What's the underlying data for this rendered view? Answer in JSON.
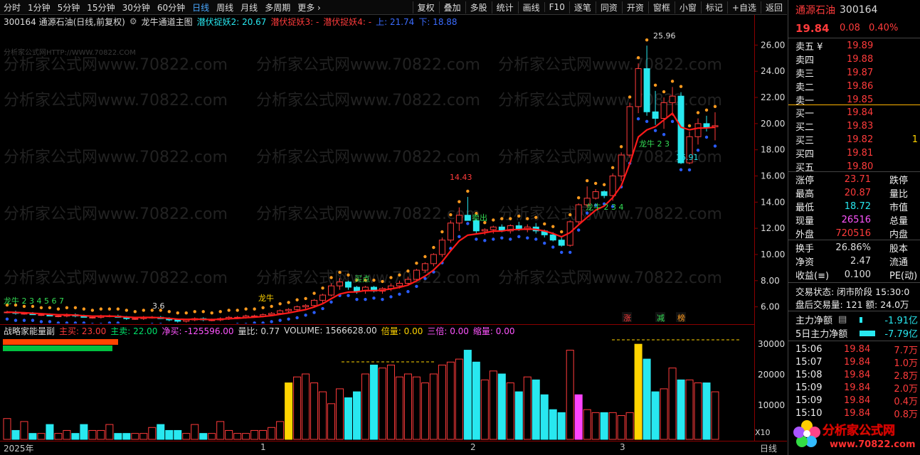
{
  "topbar": {
    "periods": [
      "分时",
      "1分钟",
      "5分钟",
      "15分钟",
      "30分钟",
      "60分钟",
      "日线",
      "周线",
      "月线",
      "多周期",
      "更多 ›"
    ],
    "active": "日线",
    "tools": [
      "复权",
      "叠加",
      "多股",
      "统计",
      "画线",
      "F10",
      "逐笔",
      "同资",
      "开资",
      "窗框",
      "小窗",
      "标记",
      "+自选",
      "返回"
    ]
  },
  "title": {
    "stock": "300164 通源石油(日线,前复权)",
    "indicator": "龙牛通道主图",
    "l1": "潜伏捉妖2: 20.67",
    "l2": "潜伏捉妖3: -",
    "l3": "潜伏捉妖4: -",
    "l4": "上: 21.74",
    "l5": "下: 18.88"
  },
  "watermark": "分析家公式网www.70822.com",
  "watermark2": "分析家公式网HTTP://WWW.70822.COM",
  "price_axis": [
    "26.00",
    "24.00",
    "22.00",
    "20.00",
    "18.00",
    "16.00",
    "14.00",
    "12.00",
    "10.00",
    "8.00",
    "6.00"
  ],
  "annotations": {
    "high": "25.96",
    "low": "16.91",
    "peak_mid": "14.43",
    "long1": "龙牛 2 3",
    "long2": "龙牛 2 3 4",
    "long3": "龙牛",
    "long4": "龙牛 2 3 4 5 6 7",
    "kd": "卖出",
    "buy": "买点",
    "label_zhang": "涨",
    "label_jian": "减",
    "label_bang": "榜",
    "bottom_low": "3.6"
  },
  "volume_title": {
    "name": "战略家能量副",
    "zm": "主买: 23.00",
    "zhm": "主卖: 22.00",
    "jm": "净买: -125596.00",
    "lb": "量比: 0.77",
    "vol": "VOLUME: 1566628.00",
    "bl": "倍量: 0.00",
    "sb": "三倍: 0.00",
    "sl": "缩量: 0.00"
  },
  "vol_axis": [
    "30000",
    "20000",
    "10000"
  ],
  "vol_unit": "X10",
  "date_axis": {
    "year": "2025年",
    "m1": "1",
    "m2": "2",
    "m3": "3",
    "unit": "日线"
  },
  "panel": {
    "name": "通源石油",
    "code": "300164",
    "price": "19.84",
    "chg": "0.08",
    "pct": "0.40%",
    "asks": [
      {
        "label": "卖五 ¥",
        "price": "19.89",
        "vol": ""
      },
      {
        "label": "卖四",
        "price": "19.88",
        "vol": ""
      },
      {
        "label": "卖三",
        "price": "19.87",
        "vol": ""
      },
      {
        "label": "卖二",
        "price": "19.86",
        "vol": ""
      },
      {
        "label": "卖一",
        "price": "19.85",
        "vol": ""
      }
    ],
    "bids": [
      {
        "label": "买一",
        "price": "19.84",
        "vol": ""
      },
      {
        "label": "买二",
        "price": "19.83",
        "vol": ""
      },
      {
        "label": "买三",
        "price": "19.82",
        "vol": "1"
      },
      {
        "label": "买四",
        "price": "19.81",
        "vol": ""
      },
      {
        "label": "买五",
        "price": "19.80",
        "vol": ""
      }
    ],
    "stats1": [
      {
        "k": "涨停",
        "v": "23.71",
        "k2": "跌停"
      },
      {
        "k": "最高",
        "v": "20.87",
        "k2": "量比"
      },
      {
        "k": "最低",
        "v": "18.72",
        "k2": "市值"
      },
      {
        "k": "现量",
        "v": "26516",
        "k2": "总量"
      },
      {
        "k": "外盘",
        "v": "720516",
        "k2": "内盘"
      }
    ],
    "stats2": [
      {
        "k": "换手",
        "v": "26.86%",
        "k2": "股本"
      },
      {
        "k": "净资",
        "v": "2.47",
        "k2": "流通"
      },
      {
        "k": "收益(≡)",
        "v": "0.100",
        "k2": "PE(动)"
      }
    ],
    "trade_state": "交易状态: 闭市阶段 15:30:0",
    "after_vol": "盘后交易量: 121  额: 24.0万",
    "main_net": "主力净额",
    "main_net_v": "-1.91亿",
    "main5": "5日主力净额",
    "main5_v": "-7.79亿",
    "ticks": [
      {
        "t": "15:06",
        "p": "19.84",
        "v": "7.7万"
      },
      {
        "t": "15:07",
        "p": "19.84",
        "v": "1.0万"
      },
      {
        "t": "15:08",
        "p": "19.84",
        "v": "2.8万"
      },
      {
        "t": "15:09",
        "p": "19.84",
        "v": "2.0万"
      },
      {
        "t": "15:09",
        "p": "19.84",
        "v": "0.4万"
      },
      {
        "t": "15:10",
        "p": "19.84",
        "v": "0.8万"
      }
    ],
    "logo": "分析家公式网",
    "logo_url": "www.70822.com"
  },
  "colors": {
    "up": "#ff3b3b",
    "down": "#28e8f0",
    "line": "#ff1a1a",
    "dot_up": "#ff9a1e",
    "dot_dn": "#2a5cff"
  },
  "chart_data": {
    "type": "candlestick",
    "y_range": [
      5,
      27
    ],
    "candles": [
      [
        5.6,
        5.7,
        5.5,
        5.6
      ],
      [
        5.6,
        5.7,
        5.4,
        5.5
      ],
      [
        5.5,
        5.6,
        5.4,
        5.5
      ],
      [
        5.5,
        5.6,
        5.4,
        5.4
      ],
      [
        5.4,
        5.5,
        5.3,
        5.4
      ],
      [
        5.4,
        5.5,
        5.3,
        5.3
      ],
      [
        5.3,
        5.4,
        5.2,
        5.3
      ],
      [
        5.3,
        5.5,
        5.2,
        5.4
      ],
      [
        5.4,
        5.5,
        5.2,
        5.3
      ],
      [
        5.3,
        5.4,
        5.2,
        5.2
      ],
      [
        5.2,
        5.3,
        5.1,
        5.2
      ],
      [
        5.2,
        5.4,
        5.1,
        5.3
      ],
      [
        5.3,
        5.4,
        5.2,
        5.3
      ],
      [
        5.3,
        5.4,
        5.2,
        5.2
      ],
      [
        5.2,
        5.3,
        5.0,
        5.1
      ],
      [
        5.1,
        5.2,
        5.0,
        5.1
      ],
      [
        5.1,
        5.3,
        5.0,
        5.2
      ],
      [
        5.2,
        5.3,
        5.1,
        5.2
      ],
      [
        5.2,
        5.3,
        5.1,
        5.1
      ],
      [
        5.1,
        5.2,
        4.9,
        5.0
      ],
      [
        5.0,
        5.1,
        4.8,
        4.9
      ],
      [
        4.9,
        5.1,
        4.8,
        5.0
      ],
      [
        5.0,
        5.2,
        4.9,
        5.1
      ],
      [
        5.1,
        5.2,
        4.9,
        5.0
      ],
      [
        5.0,
        5.1,
        4.9,
        5.0
      ],
      [
        5.0,
        5.2,
        4.9,
        5.1
      ],
      [
        5.1,
        5.3,
        5.0,
        5.2
      ],
      [
        5.2,
        5.3,
        5.1,
        5.2
      ],
      [
        5.2,
        5.4,
        5.1,
        5.3
      ],
      [
        5.3,
        5.4,
        5.2,
        5.3
      ],
      [
        5.3,
        5.5,
        5.2,
        5.4
      ],
      [
        5.4,
        5.6,
        5.3,
        5.5
      ],
      [
        5.5,
        5.8,
        5.4,
        5.7
      ],
      [
        5.7,
        5.9,
        5.5,
        5.8
      ],
      [
        5.8,
        6.1,
        5.6,
        6.0
      ],
      [
        6.0,
        6.2,
        5.8,
        6.1
      ],
      [
        6.1,
        6.6,
        6.0,
        6.5
      ],
      [
        6.5,
        7.0,
        6.3,
        6.9
      ],
      [
        6.9,
        7.8,
        6.8,
        7.6
      ],
      [
        7.6,
        8.2,
        7.3,
        7.9
      ],
      [
        7.9,
        8.0,
        7.3,
        7.5
      ],
      [
        7.5,
        7.6,
        7.0,
        7.2
      ],
      [
        7.2,
        7.6,
        7.0,
        7.5
      ],
      [
        7.5,
        7.6,
        7.1,
        7.2
      ],
      [
        7.2,
        7.5,
        7.0,
        7.4
      ],
      [
        7.4,
        7.8,
        7.2,
        7.6
      ],
      [
        7.6,
        8.0,
        7.4,
        7.8
      ],
      [
        7.8,
        8.3,
        7.6,
        8.1
      ],
      [
        8.1,
        8.9,
        8.0,
        8.8
      ],
      [
        8.8,
        9.4,
        8.6,
        9.3
      ],
      [
        9.3,
        10.1,
        9.1,
        10.0
      ],
      [
        10.0,
        11.3,
        9.8,
        11.1
      ],
      [
        11.1,
        12.6,
        10.9,
        12.4
      ],
      [
        12.4,
        13.6,
        11.8,
        13.0
      ],
      [
        13.0,
        14.4,
        12.8,
        12.6
      ],
      [
        12.6,
        12.7,
        11.6,
        11.8
      ],
      [
        11.8,
        12.0,
        11.5,
        11.9
      ],
      [
        11.9,
        12.2,
        11.6,
        12.1
      ],
      [
        12.1,
        12.3,
        11.7,
        11.8
      ],
      [
        11.8,
        12.3,
        11.6,
        12.2
      ],
      [
        12.2,
        12.5,
        11.8,
        11.9
      ],
      [
        11.9,
        12.3,
        11.7,
        12.1
      ],
      [
        12.1,
        12.4,
        11.6,
        11.8
      ],
      [
        11.8,
        11.9,
        11.3,
        11.5
      ],
      [
        11.5,
        11.7,
        11.0,
        11.1
      ],
      [
        11.1,
        11.3,
        10.6,
        10.7
      ],
      [
        10.7,
        12.6,
        10.6,
        12.5
      ],
      [
        12.5,
        13.9,
        12.3,
        13.8
      ],
      [
        13.8,
        15.2,
        13.6,
        14.3
      ],
      [
        14.3,
        15.0,
        14.2,
        14.8
      ],
      [
        14.8,
        14.9,
        14.3,
        14.5
      ],
      [
        14.5,
        16.2,
        14.1,
        16.0
      ],
      [
        16.0,
        17.8,
        15.6,
        17.6
      ],
      [
        17.6,
        21.6,
        17.4,
        21.3
      ],
      [
        21.3,
        24.6,
        20.8,
        24.2
      ],
      [
        24.2,
        25.96,
        20.6,
        20.9
      ],
      [
        20.9,
        22.5,
        19.9,
        20.4
      ],
      [
        20.4,
        22.0,
        19.6,
        21.6
      ],
      [
        21.6,
        22.8,
        20.6,
        22.1
      ],
      [
        22.1,
        22.4,
        16.91,
        17.0
      ],
      [
        17.0,
        19.4,
        16.9,
        19.0
      ],
      [
        19.0,
        20.4,
        18.4,
        20.0
      ],
      [
        20.0,
        20.6,
        19.4,
        19.7
      ],
      [
        19.76,
        20.87,
        18.72,
        19.84
      ]
    ],
    "volumes": [
      7,
      3,
      6,
      2,
      2,
      5,
      2,
      3,
      2,
      5,
      3,
      3,
      5,
      2,
      2,
      2,
      2,
      4,
      5,
      3,
      3,
      2,
      5,
      2,
      2,
      6,
      3,
      2,
      2,
      3,
      3,
      4,
      6,
      19,
      21,
      22,
      19,
      16,
      12,
      17,
      14,
      16,
      22,
      25,
      24,
      25,
      21,
      22,
      21,
      19,
      22,
      25,
      26,
      27,
      30,
      26,
      20,
      23,
      22,
      19,
      16,
      21,
      20,
      15,
      10,
      9,
      30,
      15,
      10,
      9,
      9,
      9,
      8,
      9,
      32,
      27,
      16,
      17,
      24,
      20,
      20,
      19,
      19,
      16
    ]
  }
}
